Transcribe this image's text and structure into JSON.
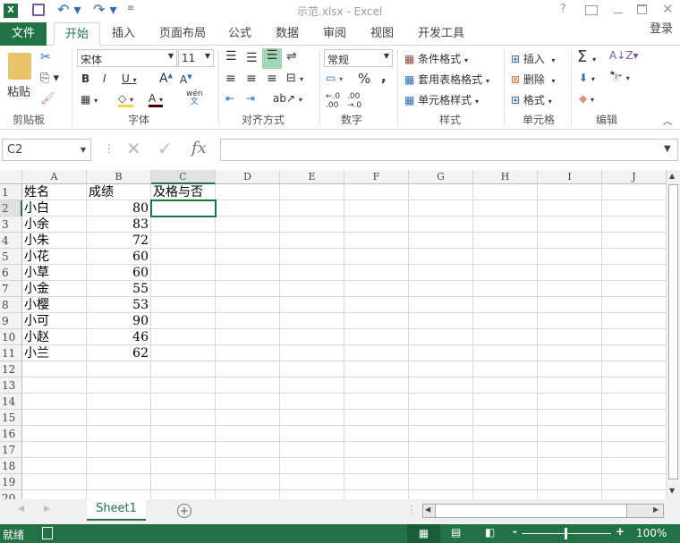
{
  "title": "示范.xlsx - Excel",
  "tabs": [
    "文件",
    "开始",
    "插入",
    "页面布局",
    "公式",
    "数据",
    "审阅",
    "视图",
    "开发工具"
  ],
  "login": "登录",
  "ribbon": {
    "clipboard": {
      "label": "剪贴板",
      "paste": "粘贴"
    },
    "font": {
      "label": "字体",
      "name": "宋体",
      "size": "11",
      "phonetic": "wén"
    },
    "alignment": {
      "label": "对齐方式"
    },
    "number": {
      "label": "数字",
      "format": "常规",
      "percent": "%",
      "comma": ","
    },
    "styles": {
      "label": "样式",
      "conditional": "条件格式",
      "table": "套用表格格式",
      "cell": "单元格样式"
    },
    "cells": {
      "label": "单元格",
      "insert": "插入",
      "delete": "删除",
      "format": "格式"
    },
    "editing": {
      "label": "编辑"
    }
  },
  "formula_bar": {
    "name_box": "C2",
    "value": "",
    "fx": "fx"
  },
  "columns": [
    "A",
    "B",
    "C",
    "D",
    "E",
    "F",
    "G",
    "H",
    "I",
    "J"
  ],
  "rows": [
    [
      "姓名",
      "成绩",
      "及格与否"
    ],
    [
      "小白",
      "80",
      ""
    ],
    [
      "小余",
      "83",
      ""
    ],
    [
      "小朱",
      "72",
      ""
    ],
    [
      "小花",
      "60",
      ""
    ],
    [
      "小草",
      "60",
      ""
    ],
    [
      "小金",
      "55",
      ""
    ],
    [
      "小樱",
      "53",
      ""
    ],
    [
      "小可",
      "90",
      ""
    ],
    [
      "小赵",
      "46",
      ""
    ],
    [
      "小兰",
      "62",
      ""
    ]
  ],
  "row_count": 20,
  "sheet_tab": "Sheet1",
  "status": {
    "ready": "就绪",
    "zoom": "100%"
  },
  "colors": {
    "accent": "#217346"
  }
}
